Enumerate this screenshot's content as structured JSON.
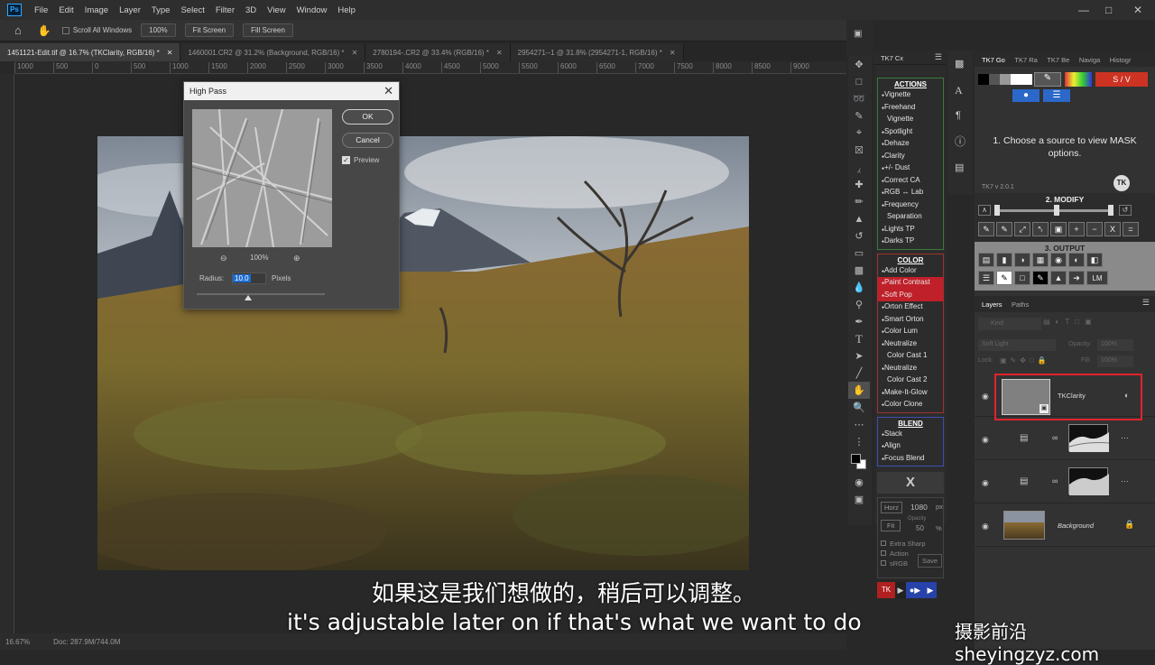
{
  "menubar": {
    "logo": "Ps",
    "items": [
      "File",
      "Edit",
      "Image",
      "Layer",
      "Type",
      "Select",
      "Filter",
      "3D",
      "View",
      "Window",
      "Help"
    ]
  },
  "optionsbar": {
    "scroll_all": "Scroll All Windows",
    "zoom": "100%",
    "fit_screen": "Fit Screen",
    "fill_screen": "Fill Screen"
  },
  "doctabs": [
    {
      "label": "1451121-Edit.tif @ 16.7% (TKClarity, RGB/16) *",
      "active": true
    },
    {
      "label": "1460001.CR2 @ 31.2% (Background, RGB/16) *",
      "active": false
    },
    {
      "label": "2780194-.CR2 @ 33.4% (RGB/16) *",
      "active": false
    },
    {
      "label": "2954271--1 @ 31.8% (2954271-1, RGB/16) *",
      "active": false
    }
  ],
  "ruler_top": [
    "1000",
    "500",
    "0",
    "500",
    "1000",
    "1500",
    "2000",
    "2500",
    "3000",
    "3500",
    "4000",
    "4500",
    "5000",
    "5500",
    "6000",
    "6500",
    "7000",
    "7500",
    "8000",
    "8500",
    "9000"
  ],
  "statusbar": {
    "zoom": "16.67%",
    "doc": "Doc: 287.9M/744.0M"
  },
  "dialog": {
    "title": "High Pass",
    "ok": "OK",
    "cancel": "Cancel",
    "preview_label": "Preview",
    "preview_zoom": "100%",
    "radius_label": "Radius:",
    "radius_value": "10.0",
    "radius_unit": "Pixels",
    "radius_slider_fraction": 0.4
  },
  "tk_panel": {
    "tab": "TK7 Cx",
    "actions_head": "ACTIONS",
    "actions": [
      "Vignette",
      "Freehand",
      "Vignette",
      "Spotlight",
      "Dehaze",
      "Clarity",
      "+/- Dust",
      "Correct CA",
      "RGB ↔ Lab",
      "Frequency",
      "Separation",
      "Lights TP",
      "Darks TP"
    ],
    "color_head": "COLOR",
    "color": [
      "Add Color",
      "Paint Contrast",
      "Soft Pop",
      "Orton Effect",
      "Smart Orton",
      "Color Lum",
      "Neutralize",
      "Color Cast 1",
      "Neutralize",
      "Color Cast 2",
      "Make-It-Glow",
      "Color Clone"
    ],
    "blend_head": "BLEND",
    "blend": [
      "Stack",
      "Align",
      "Focus Blend"
    ],
    "close": "X",
    "horz": "Horz",
    "size": "1080",
    "size_unit": "px",
    "fit": "Fit",
    "opacity_label": "Opacity",
    "opacity": "50",
    "opacity_unit": "%",
    "extra_sharp": "Extra Sharp",
    "action": "Action",
    "srgb": "sRGB",
    "save": "Save",
    "tk": "TK"
  },
  "right_panel": {
    "tabs": [
      "TK7 Go",
      "TK7 Ra",
      "TK7 Be",
      "Naviga",
      "Histogr"
    ],
    "sv": "S / V",
    "instructions": "1. Choose a source to view MASK options.",
    "version": "TK7 v 2.0.1",
    "modify": "2. MODIFY",
    "output": "3. OUTPUT",
    "lm": "LM",
    "layers_tabs": [
      "Layers",
      "Paths"
    ],
    "kind": "Kind",
    "blend_mode": "Soft Light",
    "opacity_label": "Opacity:",
    "opacity": "100%",
    "lock_label": "Lock:",
    "fill_label": "Fill:",
    "fill": "100%",
    "layers": [
      {
        "name": "TKClarity"
      },
      {
        "name": ""
      },
      {
        "name": ""
      },
      {
        "name": "Background"
      }
    ]
  },
  "subtitles": {
    "cn": "如果这是我们想做的，稍后可以调整。",
    "en": "it's adjustable later on if that's what we want to do"
  },
  "watermark": "摄影前沿 sheyingzyz.com",
  "colors": {
    "red_highlight": "#e0242c",
    "tk_red": "#c0202a",
    "accent": "#31a8ff"
  }
}
